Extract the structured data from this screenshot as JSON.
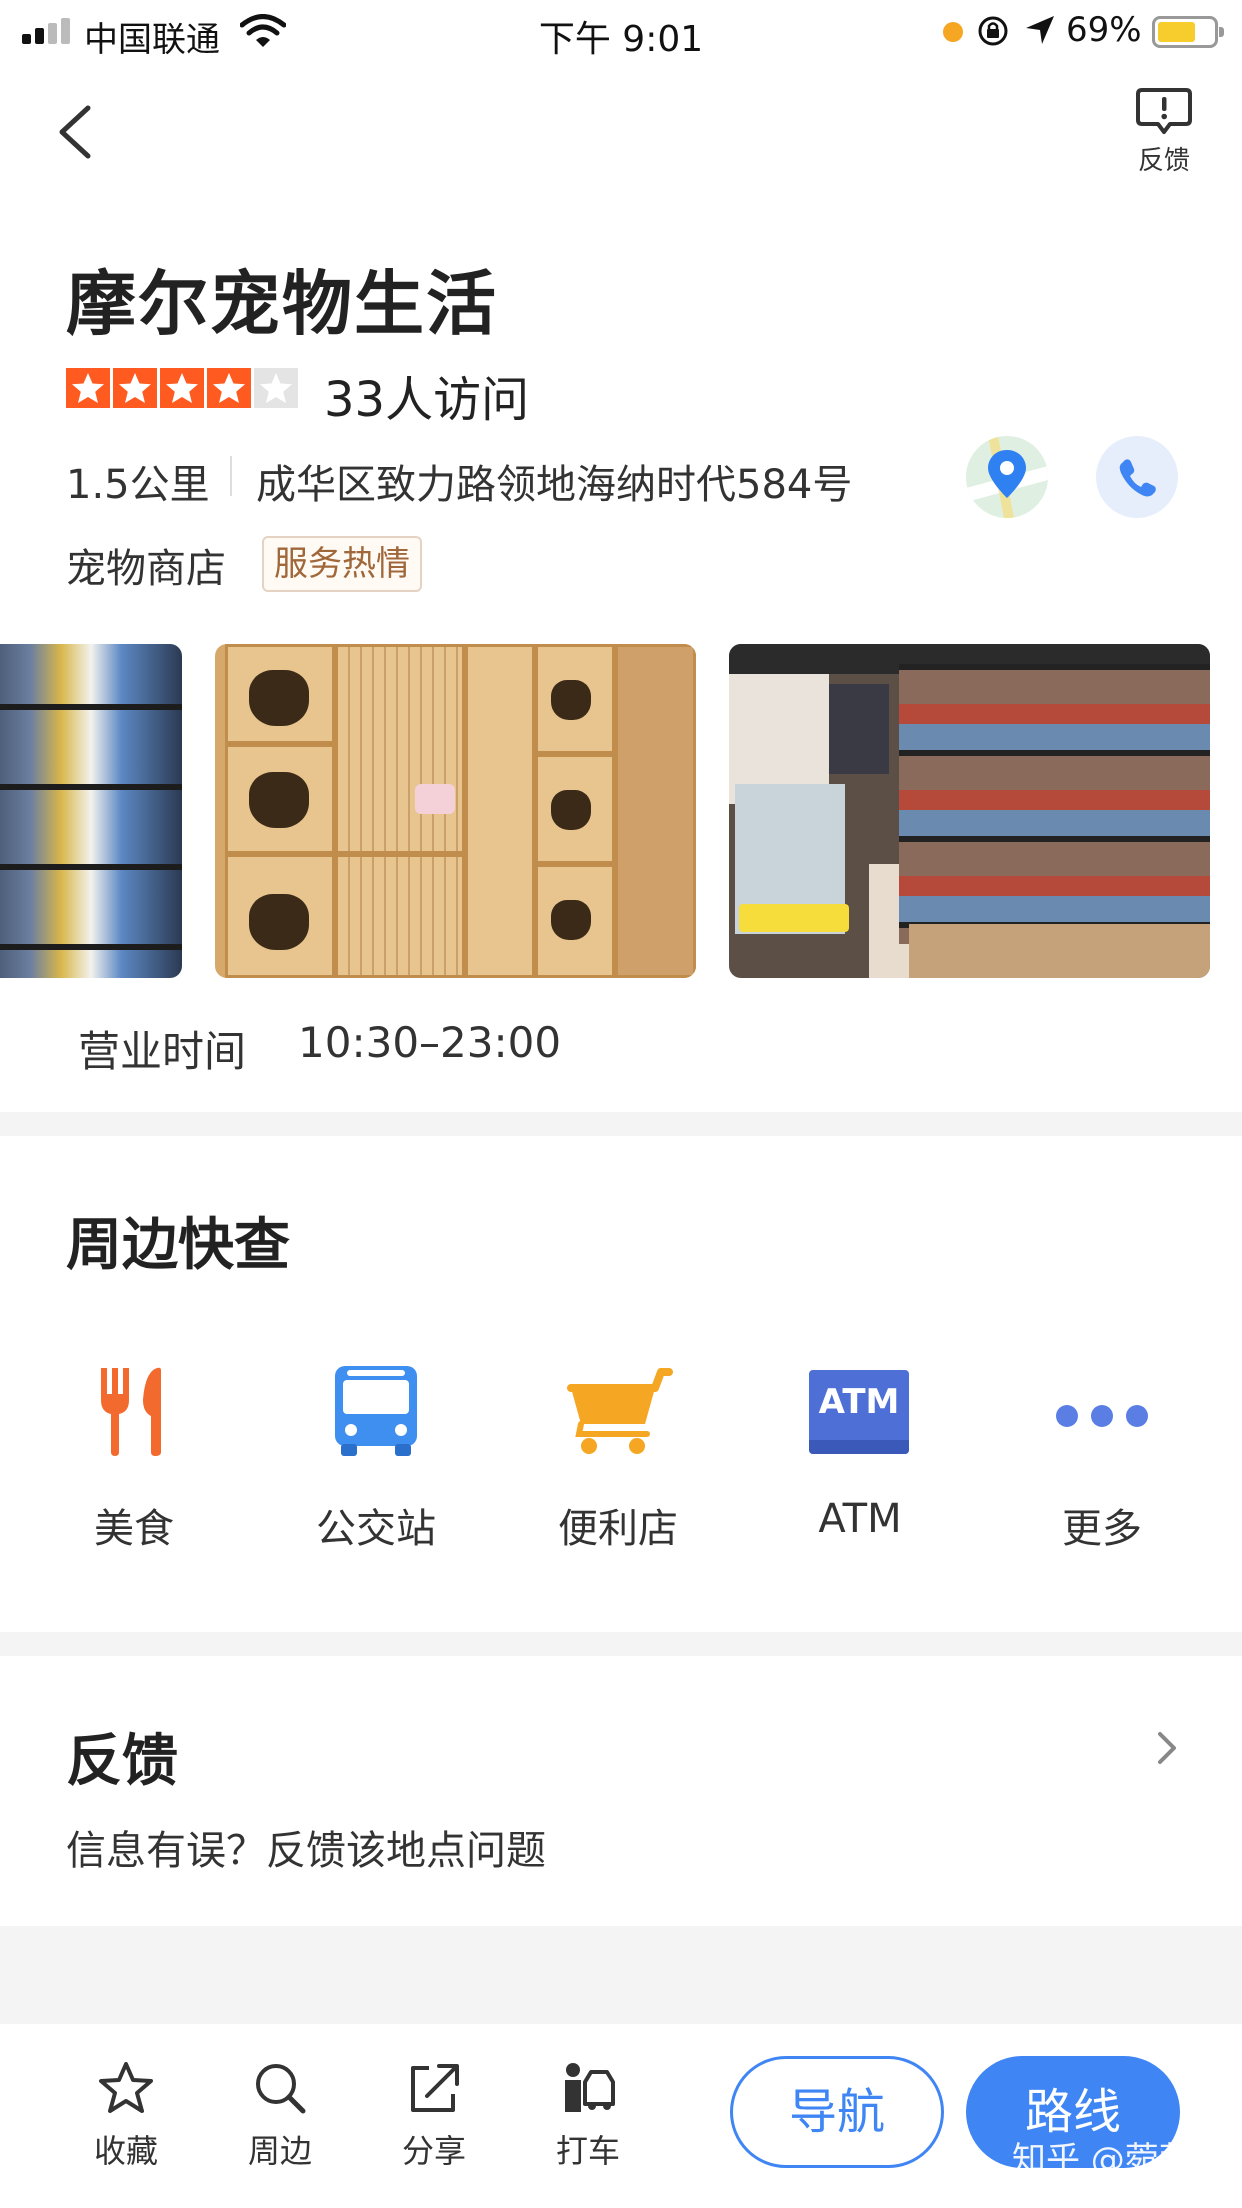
{
  "status_bar": {
    "carrier": "中国联通",
    "time": "下午 9:01",
    "battery_percent": "69%",
    "battery_level": 0.69
  },
  "nav": {
    "feedback_label": "反馈"
  },
  "place": {
    "name": "摩尔宠物生活",
    "rating": 4,
    "rating_max": 5,
    "visitors": "33人访问",
    "distance": "1.5公里",
    "address": "成华区致力路领地海纳时代584号",
    "category": "宠物商店",
    "tag": "服务热情",
    "hours_label": "营业时间",
    "hours_value": "10:30–23:00"
  },
  "nearby": {
    "title": "周边快查",
    "items": [
      {
        "label": "美食",
        "icon": "fork-knife-icon",
        "color": "#f26a2e"
      },
      {
        "label": "公交站",
        "icon": "bus-icon",
        "color": "#3f8ff0"
      },
      {
        "label": "便利店",
        "icon": "cart-icon",
        "color": "#f5a623"
      },
      {
        "label": "ATM",
        "icon": "atm-icon",
        "color": "#4d6fd6"
      },
      {
        "label": "更多",
        "icon": "more-dots-icon",
        "color": "#5b7ee5"
      }
    ],
    "atm_text": "ATM"
  },
  "feedback": {
    "title": "反馈",
    "description": "信息有误？反馈该地点问题"
  },
  "bottom_bar": {
    "favorite": "收藏",
    "nearby": "周边",
    "share": "分享",
    "taxi": "打车",
    "navigate": "导航",
    "route": "路线"
  },
  "watermark": "知乎 @菀菀",
  "colors": {
    "accent": "#3f86f4",
    "star": "#ff5a1f",
    "tag_text": "#a0683a"
  }
}
